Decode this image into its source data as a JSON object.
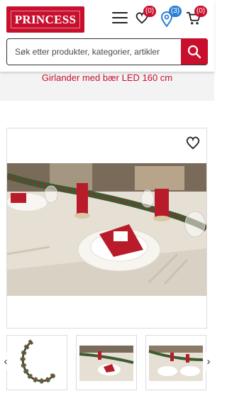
{
  "header": {
    "brand": "PRINCESS",
    "menu_icon": "hamburger-icon",
    "wishlist": {
      "icon": "heart-icon",
      "count": "(0)"
    },
    "stores": {
      "icon": "map-pin-icon",
      "count": "(3)"
    },
    "cart": {
      "icon": "cart-icon",
      "count": "(0)"
    }
  },
  "search": {
    "placeholder": "Søk etter produkter, kategorier, artikler",
    "icon": "search-icon"
  },
  "product": {
    "title": "Girlander med bær LED 160 cm"
  },
  "gallery": {
    "favorite_icon": "heart-outline-icon",
    "thumbnails": [
      "garland-product",
      "table-setting-1",
      "table-setting-2"
    ],
    "prev_icon": "chevron-left-icon",
    "next_icon": "chevron-right-icon"
  },
  "colors": {
    "brand": "#c8102e",
    "badge_blue": "#2a7fd4",
    "band": "#f3f3f3"
  }
}
